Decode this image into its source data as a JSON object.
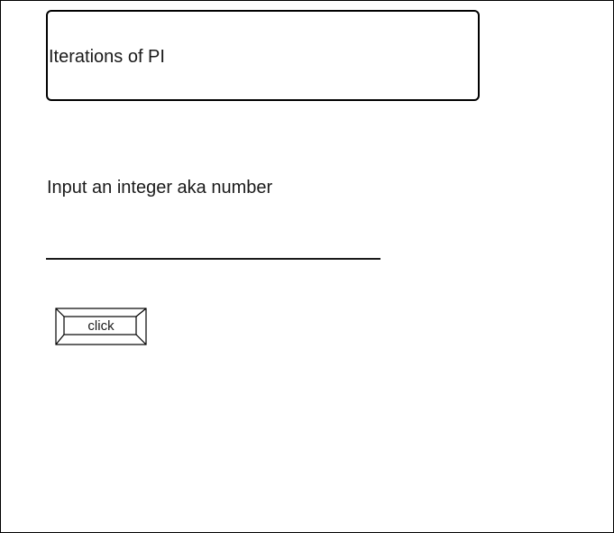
{
  "header": {
    "title": "Iterations of PI"
  },
  "form": {
    "prompt_label": "Input an integer aka number",
    "input_value": "",
    "input_placeholder": "",
    "button_label": "click"
  },
  "colors": {
    "stroke": "#000000",
    "text": "#1a1a1a",
    "background": "#ffffff"
  }
}
